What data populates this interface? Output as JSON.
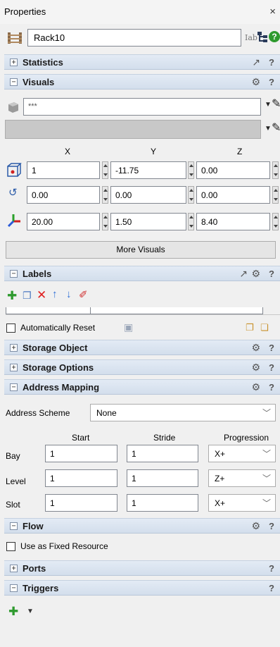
{
  "panel": {
    "title": "Properties",
    "close_glyph": "×"
  },
  "object": {
    "name": "Rack10",
    "label_icon_text": "Iab"
  },
  "sections": {
    "statistics": "Statistics",
    "visuals": "Visuals",
    "labels": "Labels",
    "storage_object": "Storage Object",
    "storage_options": "Storage Options",
    "address_mapping": "Address Mapping",
    "flow": "Flow",
    "ports": "Ports",
    "triggers": "Triggers"
  },
  "help_glyph": "?",
  "visuals": {
    "shape_value": "***",
    "columns": [
      "X",
      "Y",
      "Z"
    ],
    "location": [
      "1",
      "-11.75",
      "0.00"
    ],
    "rotation": [
      "0.00",
      "0.00",
      "0.00"
    ],
    "size": [
      "20.00",
      "1.50",
      "8.40"
    ],
    "more_visuals_label": "More Visuals"
  },
  "labels_section": {
    "auto_reset_label": "Automatically Reset",
    "auto_reset_checked": false
  },
  "address_mapping": {
    "scheme_label": "Address Scheme",
    "scheme_value": "None",
    "headers": [
      "Start",
      "Stride",
      "Progression"
    ],
    "rows": [
      {
        "name": "Bay",
        "start": "1",
        "stride": "1",
        "progression": "X+"
      },
      {
        "name": "Level",
        "start": "1",
        "stride": "1",
        "progression": "Z+"
      },
      {
        "name": "Slot",
        "start": "1",
        "stride": "1",
        "progression": "X+"
      }
    ]
  },
  "flow": {
    "fixed_resource_label": "Use as Fixed Resource",
    "fixed_resource_checked": false
  },
  "colors": {
    "section_header": "#d8e2ef",
    "panel_bg": "#f0f0f0",
    "help_green": "#2e9a2e",
    "delete_red": "#e02020",
    "arrow_blue": "#2f6fd6"
  }
}
